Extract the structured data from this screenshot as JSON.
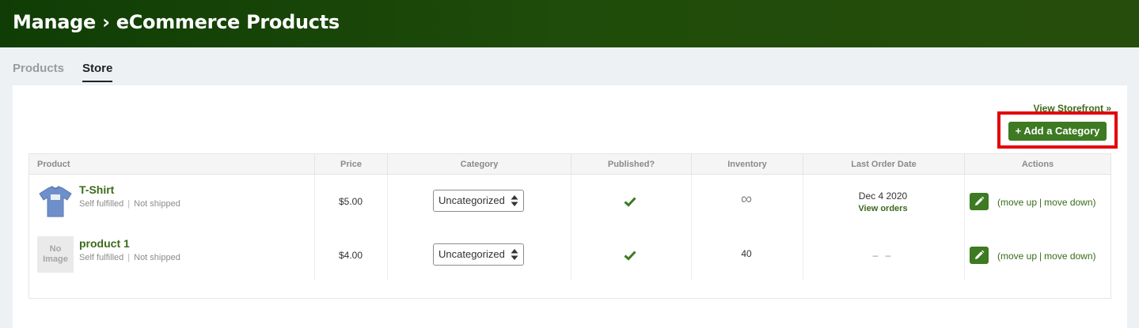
{
  "header": {
    "title": "Manage › eCommerce Products"
  },
  "tabs": [
    {
      "label": "Products",
      "active": false
    },
    {
      "label": "Store",
      "active": true
    }
  ],
  "store": {
    "view_storefront": "View Storefront »",
    "add_category": "+ Add a Category"
  },
  "table": {
    "columns": [
      "Product",
      "Price",
      "Category",
      "Published?",
      "Inventory",
      "Last Order Date",
      "Actions"
    ],
    "rows": [
      {
        "name": "T-Shirt",
        "fulfillment": "Self fulfilled",
        "shipping": "Not shipped",
        "price": "$5.00",
        "category": "Uncategorized",
        "published": true,
        "inventory": "∞",
        "last_order_date": "Dec 4 2020",
        "view_orders": "View orders",
        "move_up": "move up",
        "move_down": "move down"
      },
      {
        "name": "product 1",
        "no_image": [
          "No",
          "Image"
        ],
        "fulfillment": "Self fulfilled",
        "shipping": "Not shipped",
        "price": "$4.00",
        "category": "Uncategorized",
        "published": true,
        "inventory": "40",
        "last_order_date": "– –",
        "move_up": "move up",
        "move_down": "move down"
      }
    ]
  },
  "colors": {
    "header_dark": "#0f3d05",
    "brand_green": "#3d7a22",
    "link_green": "#3a6b19",
    "highlight_red": "#e3000b"
  },
  "icons": {
    "thumbnail": "tshirt-icon",
    "published": "checkmark-icon",
    "edit": "pencil-icon",
    "select": "select-arrows-icon"
  }
}
